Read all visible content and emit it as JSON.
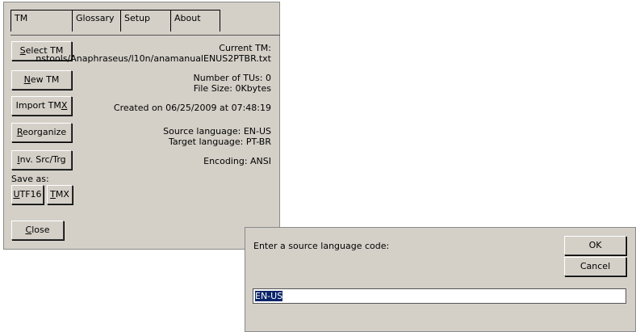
{
  "tm_window": {
    "tabs": [
      "TM",
      "Glossary",
      "Setup",
      "About"
    ],
    "buttons": {
      "select_tm": {
        "pre": "",
        "key": "S",
        "post": "elect TM"
      },
      "new_tm": {
        "pre": "",
        "key": "N",
        "post": "ew TM"
      },
      "import_tmx": {
        "pre": "Import TM",
        "key": "X",
        "post": ""
      },
      "reorganize": {
        "pre": "",
        "key": "R",
        "post": "eorganize"
      },
      "inv_src_trg": {
        "pre": "",
        "key": "I",
        "post": "nv. Src/Trg"
      },
      "utf16": {
        "pre": "",
        "key": "U",
        "post": "TF16"
      },
      "tmx": {
        "pre": "",
        "key": "T",
        "post": "MX"
      },
      "close": {
        "pre": "",
        "key": "C",
        "post": "lose"
      }
    },
    "save_as_label": "Save as:",
    "info": {
      "current_tm_label": "Current TM:",
      "current_tm_path": "nstools/Anaphraseus/l10n/anamanualENUS2PTBR.txt",
      "num_tus": "Number of TUs: 0",
      "file_size": "File Size: 0Kbytes",
      "created": "Created on 06/25/2009 at 07:48:19",
      "source_language": "Source language: EN-US",
      "target_language": "Target language: PT-BR",
      "encoding": "Encoding: ANSI"
    }
  },
  "dialog": {
    "prompt": "Enter a source language code:",
    "ok_label": "OK",
    "cancel_label": "Cancel",
    "input_value": "EN-US"
  }
}
